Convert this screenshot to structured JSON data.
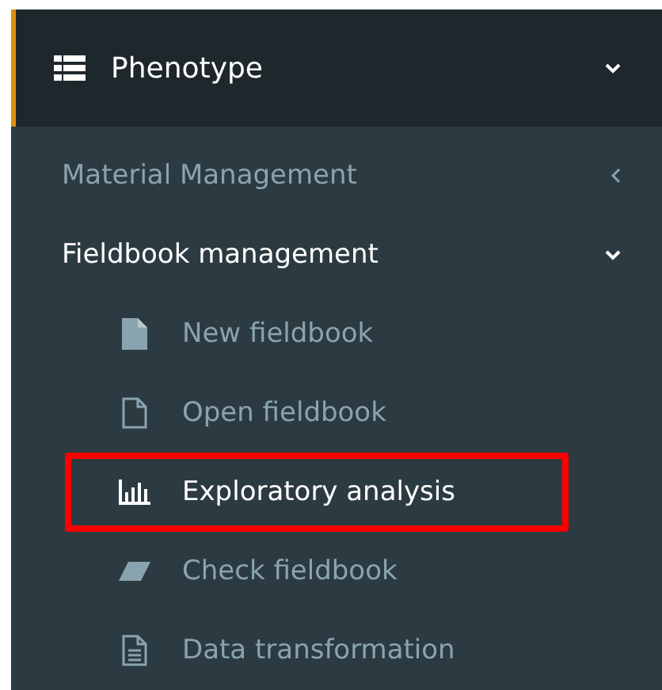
{
  "menu": {
    "label": "Phenotype",
    "expanded": true,
    "children": [
      {
        "label": "Material Management",
        "expanded": false,
        "selected": false
      },
      {
        "label": "Fieldbook management",
        "expanded": true,
        "selected": true,
        "children": [
          {
            "kind": "new",
            "label": "New fieldbook",
            "selected": false,
            "highlighted": false
          },
          {
            "kind": "open",
            "label": "Open fieldbook",
            "selected": false,
            "highlighted": false
          },
          {
            "kind": "chart",
            "label": "Exploratory analysis",
            "selected": true,
            "highlighted": true
          },
          {
            "kind": "eraser",
            "label": "Check fieldbook",
            "selected": false,
            "highlighted": false
          },
          {
            "kind": "document",
            "label": "Data transformation",
            "selected": false,
            "highlighted": false
          }
        ]
      }
    ]
  }
}
